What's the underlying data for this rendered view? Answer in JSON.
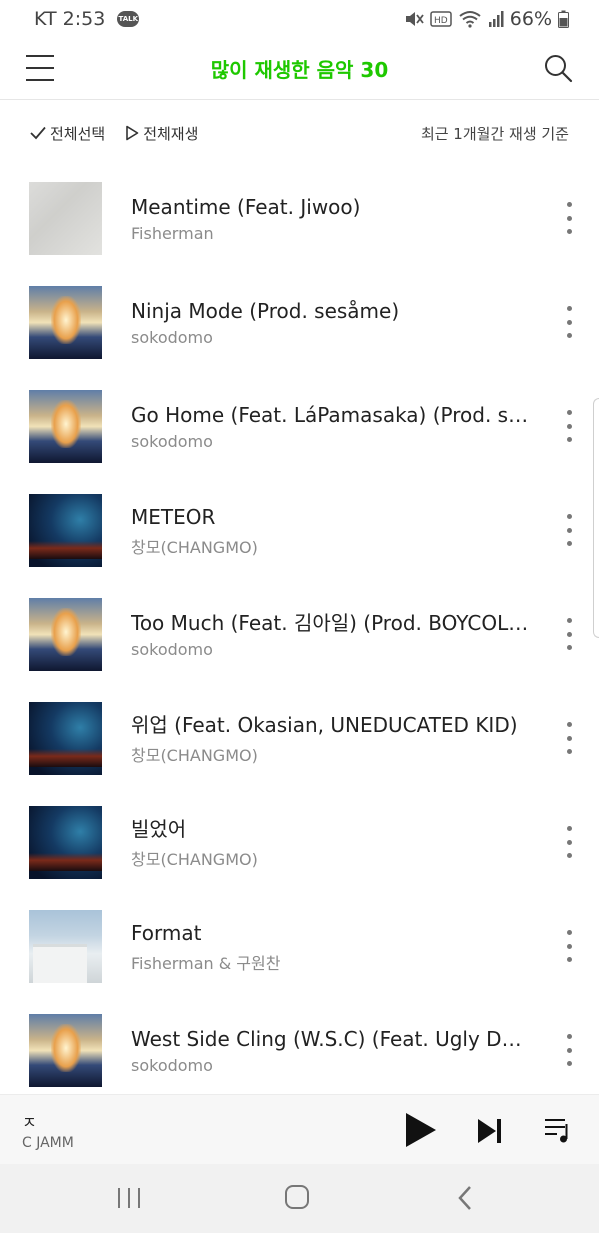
{
  "status_bar": {
    "carrier_time": "KT 2:53",
    "talk_badge": "TALK",
    "battery": "66%"
  },
  "header": {
    "title": "많이 재생한 음악 30"
  },
  "toolbar": {
    "select_all": "전체선택",
    "play_all": "전체재생",
    "period_note": "최근 1개월간 재생 기준"
  },
  "songs": [
    {
      "title": "Meantime (Feat. Jiwoo)",
      "artist": "Fisherman",
      "cover": "cracked"
    },
    {
      "title": "Ninja Mode (Prod. sesåme)",
      "artist": "sokodomo",
      "cover": "sokodomo"
    },
    {
      "title": "Go Home (Feat. LáPamasaka) (Prod. se…",
      "artist": "sokodomo",
      "cover": "sokodomo"
    },
    {
      "title": "METEOR",
      "artist": "창모(CHANGMO)",
      "cover": "meteor"
    },
    {
      "title": "Too Much (Feat. 김아일) (Prod. BOYCOLD)",
      "artist": "sokodomo",
      "cover": "sokodomo"
    },
    {
      "title": "위업 (Feat. Okasian, UNEDUCATED KID)",
      "artist": "창모(CHANGMO)",
      "cover": "meteor"
    },
    {
      "title": "빌었어",
      "artist": "창모(CHANGMO)",
      "cover": "meteor"
    },
    {
      "title": "Format",
      "artist": "Fisherman & 구원찬",
      "cover": "format"
    },
    {
      "title": "West Side Cling (W.S.C) (Feat. Ugly Duc…",
      "artist": "sokodomo",
      "cover": "sokodomo"
    }
  ],
  "now_playing": {
    "title": "ㅈ",
    "artist": "C JAMM"
  },
  "colors": {
    "accent": "#1ec800"
  },
  "icons": {
    "menu": "hamburger-icon",
    "search": "search-icon",
    "check": "check-icon",
    "play_small": "play-outline-icon",
    "more": "more-vertical-icon",
    "play": "play-icon",
    "next": "skip-next-icon",
    "queue": "playlist-icon"
  }
}
